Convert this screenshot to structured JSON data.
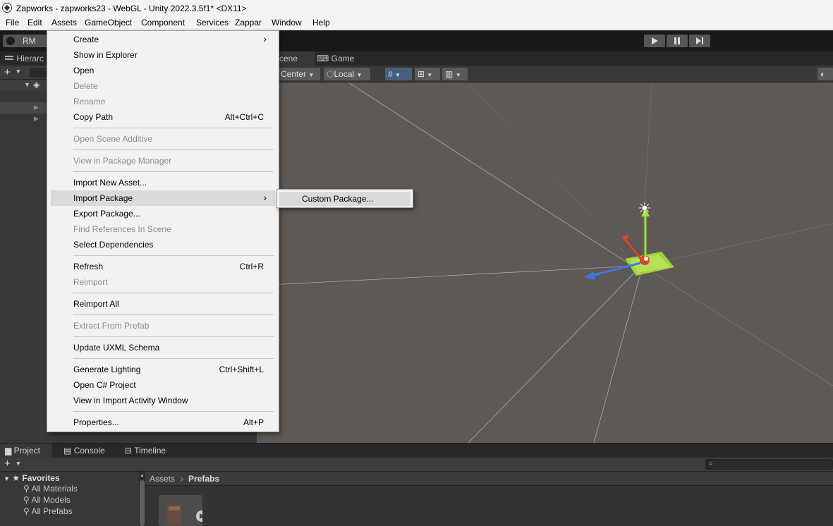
{
  "window": {
    "title": "Zapworks - zapworks23 - WebGL - Unity 2022.3.5f1* <DX11>"
  },
  "menubar": [
    "File",
    "Edit",
    "Assets",
    "GameObject",
    "Component",
    "Services",
    "Zappar",
    "Window",
    "Help"
  ],
  "toolbar": {
    "account": "RM"
  },
  "hierarchy": {
    "tab": "Hierarc"
  },
  "scene": {
    "tab_scene": "cene",
    "tab_game": "Game",
    "pivot": "Center",
    "space": "Local"
  },
  "assets_menu": {
    "items": [
      {
        "label": "Create",
        "shortcut": "",
        "arrow": true,
        "disabled": false
      },
      {
        "label": "Show in Explorer",
        "shortcut": "",
        "disabled": false
      },
      {
        "label": "Open",
        "shortcut": "",
        "disabled": false
      },
      {
        "label": "Delete",
        "shortcut": "",
        "disabled": true
      },
      {
        "label": "Rename",
        "shortcut": "",
        "disabled": true
      },
      {
        "label": "Copy Path",
        "shortcut": "Alt+Ctrl+C",
        "disabled": false
      },
      {
        "label": "Open Scene Additive",
        "shortcut": "",
        "disabled": true
      },
      {
        "label": "View in Package Manager",
        "shortcut": "",
        "disabled": true
      },
      {
        "label": "Import New Asset...",
        "shortcut": "",
        "disabled": false
      },
      {
        "label": "Import Package",
        "shortcut": "",
        "arrow": true,
        "disabled": false,
        "highlighted": true
      },
      {
        "label": "Export Package...",
        "shortcut": "",
        "disabled": false
      },
      {
        "label": "Find References In Scene",
        "shortcut": "",
        "disabled": true
      },
      {
        "label": "Select Dependencies",
        "shortcut": "",
        "disabled": false
      },
      {
        "label": "Refresh",
        "shortcut": "Ctrl+R",
        "disabled": false
      },
      {
        "label": "Reimport",
        "shortcut": "",
        "disabled": true
      },
      {
        "label": "Reimport All",
        "shortcut": "",
        "disabled": false
      },
      {
        "label": "Extract From Prefab",
        "shortcut": "",
        "disabled": true
      },
      {
        "label": "Update UXML Schema",
        "shortcut": "",
        "disabled": false
      },
      {
        "label": "Generate Lighting",
        "shortcut": "Ctrl+Shift+L",
        "disabled": false
      },
      {
        "label": "Open C# Project",
        "shortcut": "",
        "disabled": false
      },
      {
        "label": "View in Import Activity Window",
        "shortcut": "",
        "disabled": false
      },
      {
        "label": "Properties...",
        "shortcut": "Alt+P",
        "disabled": false
      }
    ]
  },
  "import_package_submenu": {
    "items": [
      "Custom Package..."
    ]
  },
  "bottom": {
    "tabs": [
      "Project",
      "Console",
      "Timeline"
    ],
    "favorites": {
      "title": "Favorites",
      "items": [
        "All Materials",
        "All Models",
        "All Prefabs"
      ]
    },
    "breadcrumb": [
      "Assets",
      "Prefabs"
    ]
  }
}
